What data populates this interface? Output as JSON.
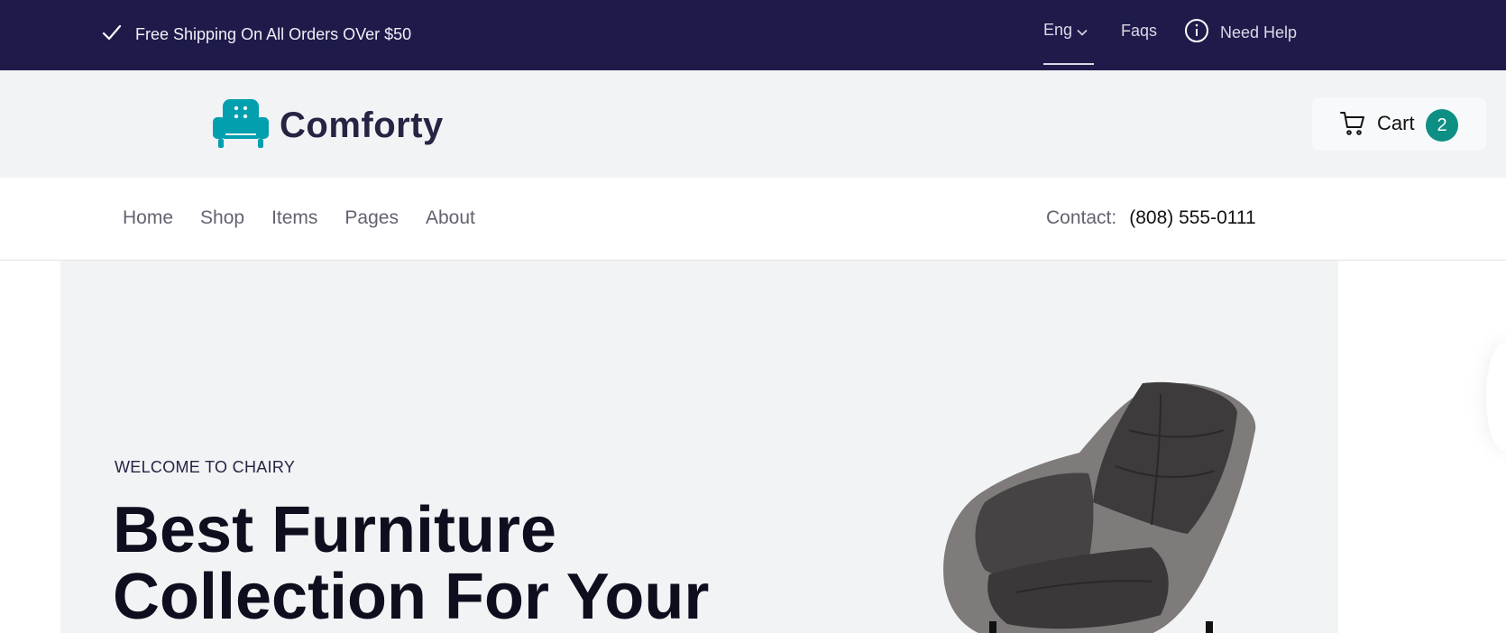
{
  "topbar": {
    "shipping_text": "Free Shipping On All Orders OVer $50",
    "language": "Eng",
    "faqs": "Faqs",
    "help": "Need Help"
  },
  "header": {
    "brand": "Comforty",
    "cart_label": "Cart",
    "cart_count": "2"
  },
  "nav": {
    "links": [
      "Home",
      "Shop",
      "Items",
      "Pages",
      "About"
    ],
    "contact_label": "Contact:",
    "contact_phone": "(808) 555-0111"
  },
  "hero": {
    "welcome": "WELCOME TO CHAIRY",
    "headline_line1": "Best Furniture",
    "headline_line2": "Collection For Your"
  },
  "colors": {
    "topbar_bg": "#1e1b4b",
    "header_bg": "#f2f3f5",
    "brand_accent": "#029fae",
    "badge": "#0e8f84",
    "text_dark": "#272343"
  },
  "icons": {
    "shipping": "check-icon",
    "language": "chevron-down-icon",
    "help": "info-icon",
    "logo": "armchair-icon",
    "cart": "cart-icon"
  }
}
